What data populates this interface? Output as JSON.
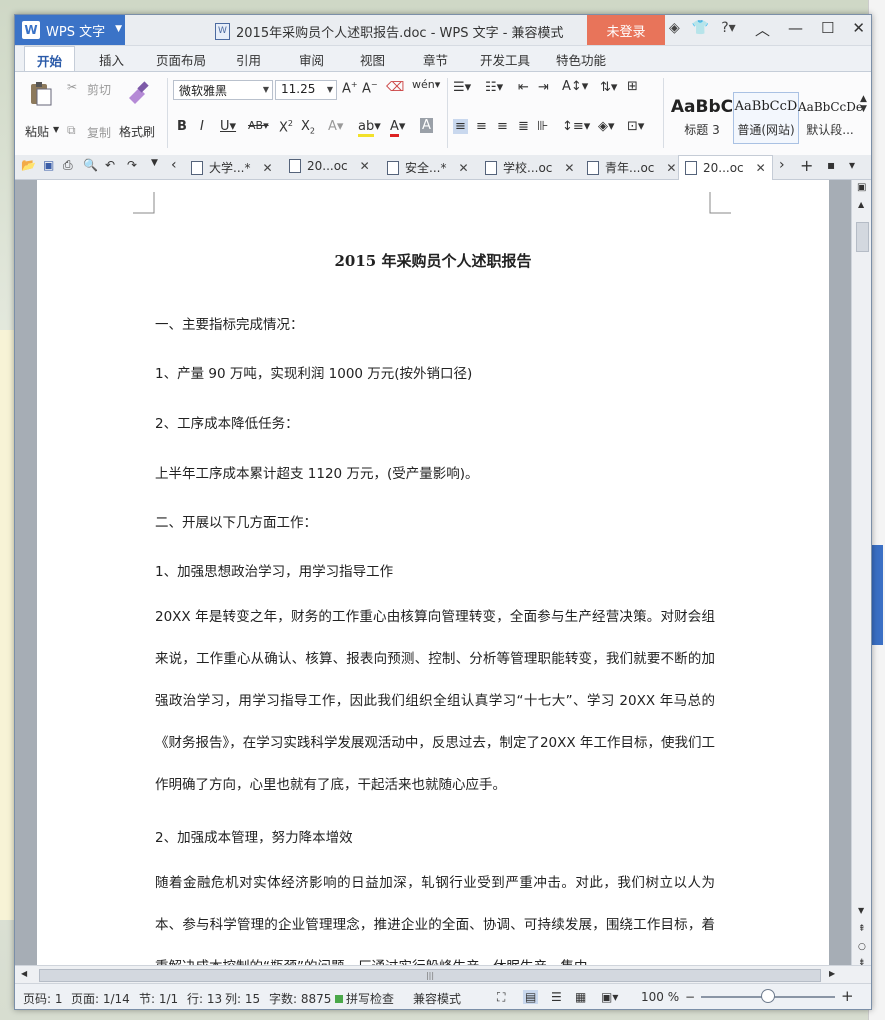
{
  "window": {
    "app_button": "WPS 文字",
    "title": "2015年采购员个人述职报告.doc - WPS 文字 - 兼容模式",
    "login": "未登录"
  },
  "ribbon_tabs": [
    "开始",
    "插入",
    "页面布局",
    "引用",
    "审阅",
    "视图",
    "章节",
    "开发工具",
    "特色功能"
  ],
  "ribbon": {
    "paste": "粘贴",
    "cut": "剪切",
    "copy": "复制",
    "format_painter": "格式刷",
    "font_name": "微软雅黑",
    "font_size": "11.25",
    "styles": [
      {
        "sample": "AaBbC",
        "name": "标题 3"
      },
      {
        "sample": "AaBbCcD",
        "name": "普通(网站)"
      },
      {
        "sample": "AaBbCcDe",
        "name": "默认段..."
      }
    ]
  },
  "doc_tabs": [
    "大学...*",
    "20...oc",
    "安全...*",
    "学校...oc",
    "青年...oc",
    "20...oc"
  ],
  "document": {
    "title": "2015 年采购员个人述职报告",
    "lines": [
      "一、主要指标完成情况：",
      "1、产量 90 万吨，实现利润 1000 万元(按外销口径)",
      "2、工序成本降低任务：",
      "上半年工序成本累计超支 1120 万元，(受产量影响)。",
      "二、开展以下几方面工作：",
      "1、加强思想政治学习，用学习指导工作"
    ],
    "para1": "20XX 年是转变之年，财务的工作重心由核算向管理转变，全面参与生产经营决策。对财会组来说，工作重心从确认、核算、报表向预测、控制、分析等管理职能转变，我们就要不断的加强政治学习，用学习指导工作，因此我们组织全组认真学习“十七大”、学习 20XX 年马总的《财务报告》，在学习实践科学发展观活动中，反思过去，制定了20XX 年工作目标，使我们工作明确了方向，心里也就有了底，干起活来也就随心应手。",
    "line7": "2、加强成本管理，努力降本增效",
    "para2": "随着金融危机对实体经济影响的日益加深，轧钢行业受到严重冲击。对此，我们树立以人为本、参与科学管理的企业管理理念，推进企业的全面、协调、可持续发展，围绕工作目标，着重解决成本控制的“瓶颈”的问题。厂通过实行躲峰生产、休眠生产、集中"
  },
  "status": {
    "page_code": "页码: 1",
    "pages": "页面: 1/14",
    "section": "节: 1/1",
    "row": "行: 13",
    "col": "列: 15",
    "words": "字数: 8875",
    "spell": "拼写检查",
    "compat": "兼容模式",
    "zoom": "100 %"
  },
  "colors": {
    "accent": "#3b73c7",
    "login": "#e8745a"
  }
}
